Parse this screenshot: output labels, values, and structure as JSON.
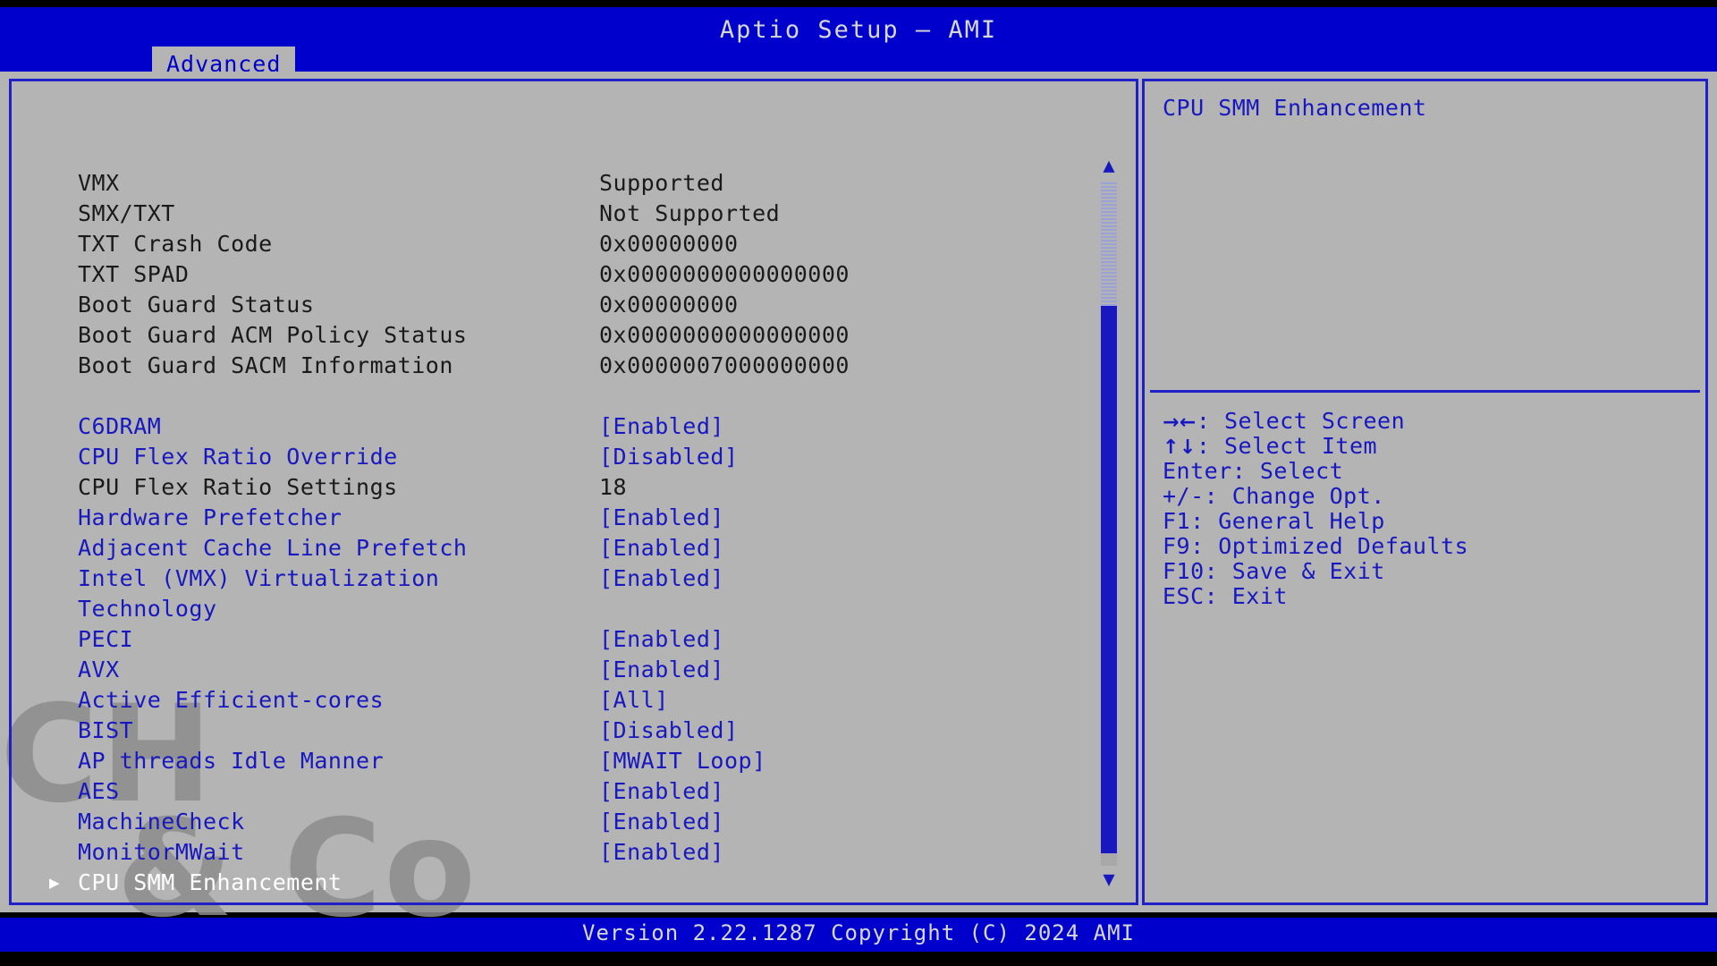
{
  "window": {
    "title": "Aptio Setup – AMI",
    "tabs": [
      {
        "label": "Advanced",
        "active": true
      }
    ]
  },
  "main": {
    "rows": [
      {
        "type": "readonly",
        "label": "VMX",
        "value": "Supported"
      },
      {
        "type": "readonly",
        "label": "SMX/TXT",
        "value": "Not Supported"
      },
      {
        "type": "readonly",
        "label": "TXT Crash Code",
        "value": "0x00000000"
      },
      {
        "type": "readonly",
        "label": "TXT SPAD",
        "value": "0x0000000000000000"
      },
      {
        "type": "readonly",
        "label": "Boot Guard Status",
        "value": "0x00000000"
      },
      {
        "type": "readonly",
        "label": "Boot Guard ACM Policy Status",
        "value": "0x0000000000000000"
      },
      {
        "type": "readonly",
        "label": "Boot Guard SACM Information",
        "value": "0x0000007000000000"
      },
      {
        "type": "spacer",
        "label": "",
        "value": ""
      },
      {
        "type": "option",
        "label": "C6DRAM",
        "value": "[Enabled]"
      },
      {
        "type": "option",
        "label": "CPU Flex Ratio Override",
        "value": "[Disabled]"
      },
      {
        "type": "readonly",
        "label": "CPU Flex Ratio Settings",
        "value": "18"
      },
      {
        "type": "option",
        "label": "Hardware Prefetcher",
        "value": "[Enabled]"
      },
      {
        "type": "option",
        "label": "Adjacent Cache Line Prefetch",
        "value": "[Enabled]"
      },
      {
        "type": "option",
        "label": "Intel (VMX) Virtualization",
        "value": "[Enabled]"
      },
      {
        "type": "option",
        "label": "Technology",
        "value": ""
      },
      {
        "type": "option",
        "label": "PECI",
        "value": "[Enabled]"
      },
      {
        "type": "option",
        "label": "AVX",
        "value": "[Enabled]"
      },
      {
        "type": "option",
        "label": "Active Efficient-cores",
        "value": "[All]"
      },
      {
        "type": "option",
        "label": "BIST",
        "value": "[Disabled]"
      },
      {
        "type": "option",
        "label": "AP threads Idle Manner",
        "value": "[MWAIT Loop]"
      },
      {
        "type": "option",
        "label": "AES",
        "value": "[Enabled]"
      },
      {
        "type": "option",
        "label": "MachineCheck",
        "value": "[Enabled]"
      },
      {
        "type": "option",
        "label": "MonitorMWait",
        "value": "[Enabled]"
      },
      {
        "type": "selected",
        "label": "CPU SMM Enhancement",
        "value": "",
        "submenu": true,
        "arrow_glyph": "▶"
      }
    ]
  },
  "scrollbar": {
    "up_glyph": "▲",
    "down_glyph": "▼"
  },
  "help": {
    "title": "CPU SMM Enhancement",
    "keys": [
      {
        "glyph": "→←",
        "text": ": Select Screen"
      },
      {
        "glyph": "↑↓",
        "text": ": Select Item"
      },
      {
        "glyph": "",
        "text": "Enter: Select"
      },
      {
        "glyph": "",
        "text": "+/-: Change Opt."
      },
      {
        "glyph": "",
        "text": "F1: General Help"
      },
      {
        "glyph": "",
        "text": "F9: Optimized Defaults"
      },
      {
        "glyph": "",
        "text": "F10: Save & Exit"
      },
      {
        "glyph": "",
        "text": "ESC: Exit"
      }
    ]
  },
  "footer": {
    "text": "Version 2.22.1287 Copyright (C) 2024 AMI"
  },
  "watermark": {
    "line1": "CH",
    "line2": "& Co"
  },
  "colors": {
    "header_blue": "#0000cc",
    "body_grey": "#b4b4b4",
    "option_blue": "#1818c0",
    "readonly_black": "#1a1a1a",
    "selected_white": "#ffffff",
    "border_blue": "#2020c8"
  }
}
